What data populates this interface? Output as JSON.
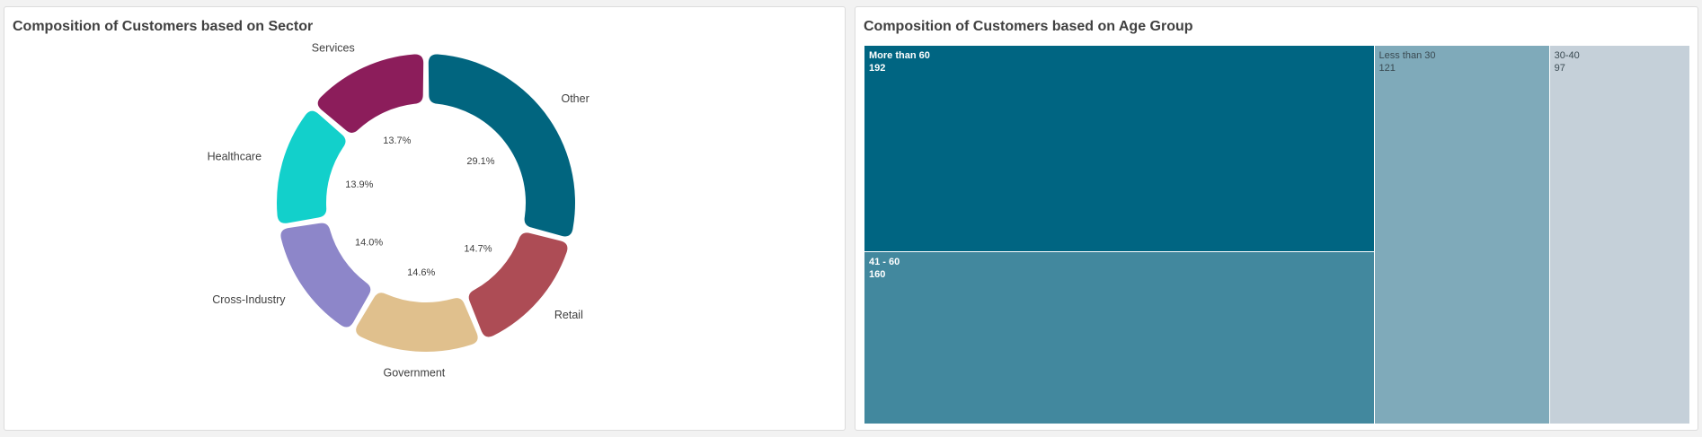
{
  "panels": {
    "sector": {
      "title": "Composition of Customers based on Sector"
    },
    "age": {
      "title": "Composition of Customers based on Age Group"
    }
  },
  "chart_data": [
    {
      "type": "pie",
      "variant": "donut",
      "title": "Composition of Customers based on Sector",
      "slices": [
        {
          "label": "Other",
          "value": 29.1,
          "value_label": "29.1%",
          "color": "#01657f"
        },
        {
          "label": "Retail",
          "value": 14.7,
          "value_label": "14.7%",
          "color": "#ad4c55"
        },
        {
          "label": "Government",
          "value": 14.6,
          "value_label": "14.6%",
          "color": "#e0c08d"
        },
        {
          "label": "Cross-Industry",
          "value": 14.0,
          "value_label": "14.0%",
          "color": "#8d86c9"
        },
        {
          "label": "Healthcare",
          "value": 13.9,
          "value_label": "13.9%",
          "color": "#12d0cb"
        },
        {
          "label": "Services",
          "value": 13.7,
          "value_label": "13.7%",
          "color": "#8c1d5b"
        }
      ]
    },
    {
      "type": "treemap",
      "title": "Composition of Customers based on Age Group",
      "items": [
        {
          "label": "More than 60",
          "value": 192,
          "value_label": "192",
          "color": "#006582",
          "text_color": "#ffffff",
          "bold": true
        },
        {
          "label": "41 - 60",
          "value": 160,
          "value_label": "160",
          "color": "#42889e",
          "text_color": "#ffffff",
          "bold": true
        },
        {
          "label": "Less than 30",
          "value": 121,
          "value_label": "121",
          "color": "#7faaba",
          "text_color": "#3a4a52",
          "bold": false
        },
        {
          "label": "30-40",
          "value": 97,
          "value_label": "97",
          "color": "#c5d0d9",
          "text_color": "#3a4a52",
          "bold": false
        }
      ]
    }
  ]
}
